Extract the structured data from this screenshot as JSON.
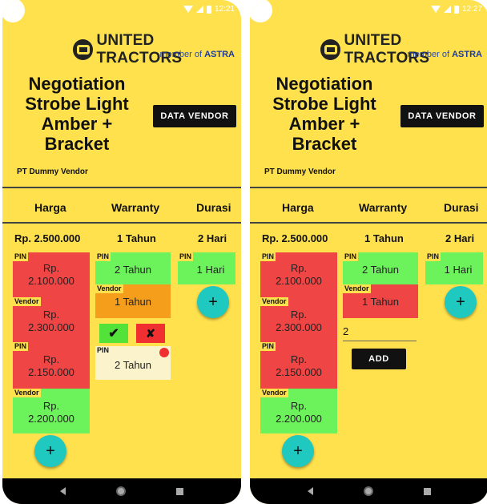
{
  "screens": [
    {
      "status_time": "12:21",
      "brand": {
        "name": "UNITED TRACTORS",
        "member_prefix": "member of",
        "member_of": "ASTRA"
      },
      "title": "Negotiation Strobe Light Amber + Bracket",
      "data_vendor_button": "DATA VENDOR",
      "vendor_name": "PT Dummy Vendor",
      "columns": {
        "harga": "Harga",
        "warranty": "Warranty",
        "durasi": "Durasi"
      },
      "current": {
        "harga": "Rp. 2.500.000",
        "warranty": "1 Tahun",
        "durasi": "2 Hari"
      },
      "harga_offers": [
        {
          "tag": "PIN",
          "value": "Rp. 2.100.000",
          "color": "#F04545"
        },
        {
          "tag": "Vendor",
          "value": "Rp. 2.300.000",
          "color": "#F04545"
        },
        {
          "tag": "PIN",
          "value": "Rp. 2.150.000",
          "color": "#F04545"
        },
        {
          "tag": "Vendor",
          "value": "Rp. 2.200.000",
          "color": "#6CF25A"
        }
      ],
      "warranty_offers": [
        {
          "tag": "PIN",
          "value": "2 Tahun",
          "color": "#6CF25A"
        },
        {
          "tag": "Vendor",
          "value": "1 Tahun",
          "color": "#F59E1B"
        }
      ],
      "warranty_pending": {
        "tag": "PIN",
        "value": "2 Tahun"
      },
      "accept_icon": "✔",
      "reject_icon": "✘",
      "durasi_offers": [
        {
          "tag": "PIN",
          "value": "1 Hari",
          "color": "#6CF25A"
        }
      ],
      "add_icon": "+"
    },
    {
      "status_time": "12:27",
      "brand": {
        "name": "UNITED TRACTORS",
        "member_prefix": "member of",
        "member_of": "ASTRA"
      },
      "title": "Negotiation Strobe Light Amber + Bracket",
      "data_vendor_button": "DATA VENDOR",
      "vendor_name": "PT Dummy Vendor",
      "columns": {
        "harga": "Harga",
        "warranty": "Warranty",
        "durasi": "Durasi"
      },
      "current": {
        "harga": "Rp. 2.500.000",
        "warranty": "1 Tahun",
        "durasi": "2 Hari"
      },
      "harga_offers": [
        {
          "tag": "PIN",
          "value": "Rp. 2.100.000",
          "color": "#F04545"
        },
        {
          "tag": "Vendor",
          "value": "Rp. 2.300.000",
          "color": "#F04545"
        },
        {
          "tag": "PIN",
          "value": "Rp. 2.150.000",
          "color": "#F04545"
        },
        {
          "tag": "Vendor",
          "value": "Rp. 2.200.000",
          "color": "#6CF25A"
        }
      ],
      "warranty_offers": [
        {
          "tag": "PIN",
          "value": "2 Tahun",
          "color": "#6CF25A"
        },
        {
          "tag": "Vendor",
          "value": "1 Tahun",
          "color": "#F04545"
        }
      ],
      "warranty_input_value": "2",
      "add_button": "ADD",
      "durasi_offers": [
        {
          "tag": "PIN",
          "value": "1 Hari",
          "color": "#6CF25A"
        }
      ],
      "add_icon": "+"
    }
  ],
  "nav_icons": [
    "back-icon",
    "home-icon",
    "recents-icon"
  ]
}
